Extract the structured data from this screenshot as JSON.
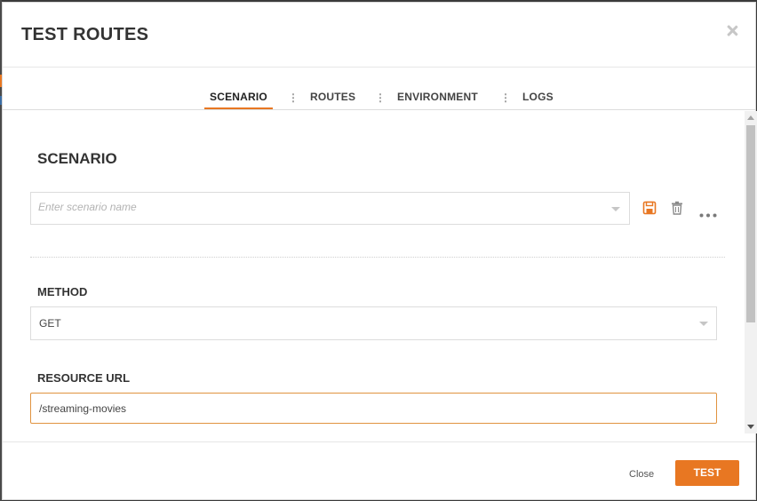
{
  "colors": {
    "accent": "#e87722",
    "text": "#333333",
    "border": "#dcdcdc"
  },
  "header": {
    "title": "TEST ROUTES",
    "close_icon": "close-icon"
  },
  "tabs": [
    {
      "label": "SCENARIO",
      "active": true
    },
    {
      "label": "ROUTES",
      "active": false
    },
    {
      "label": "ENVIRONMENT",
      "active": false
    },
    {
      "label": "LOGS",
      "active": false
    }
  ],
  "tab_separator": "⋮",
  "scenario": {
    "title": "SCENARIO",
    "name_placeholder": "Enter scenario name",
    "name_value": "",
    "icons": [
      "save-icon",
      "trash-icon",
      "more-horizontal-icon"
    ]
  },
  "method": {
    "label": "METHOD",
    "value": "GET"
  },
  "resource_url": {
    "label": "RESOURCE URL",
    "value": "/streaming-movies"
  },
  "footer": {
    "close_label": "Close",
    "test_label": "TEST"
  }
}
